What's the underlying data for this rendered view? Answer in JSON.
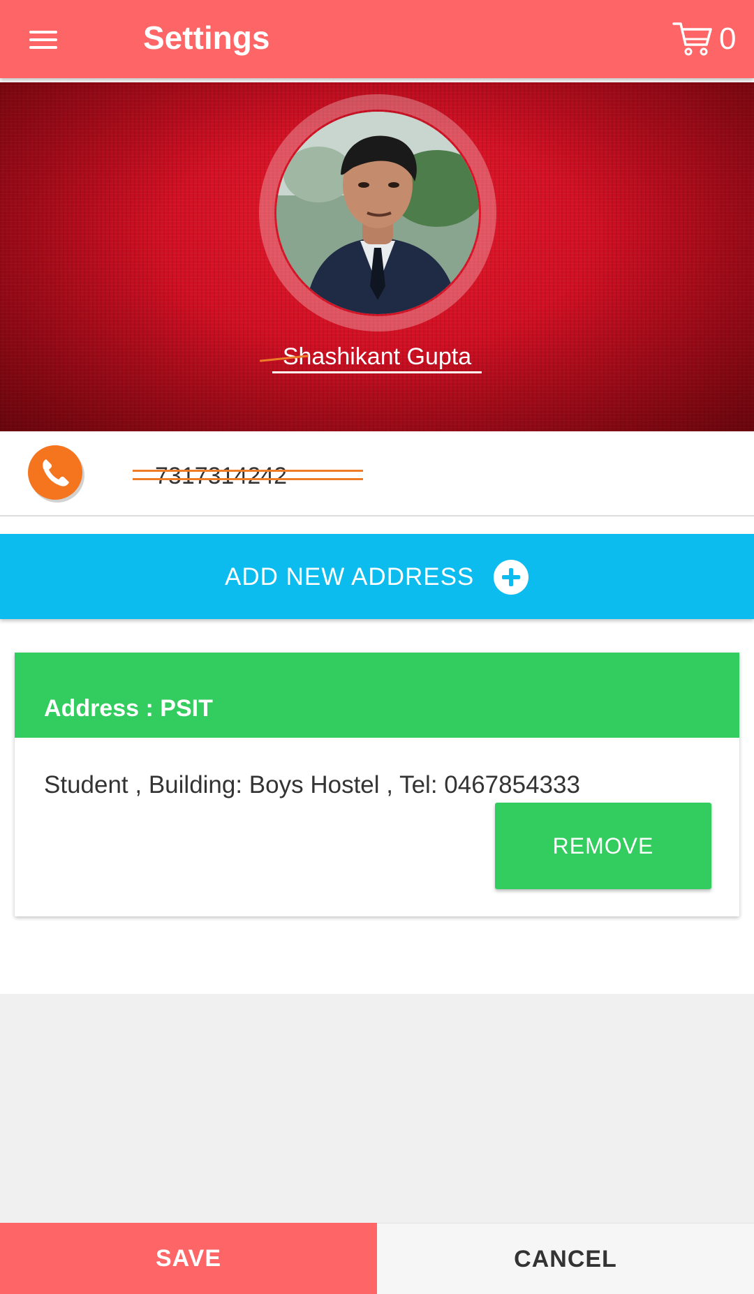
{
  "app_bar": {
    "title": "Settings",
    "cart_count": "0",
    "menu_icon": "hamburger-menu-icon",
    "cart_icon": "shopping-cart-icon"
  },
  "profile": {
    "name": "Shashikant Gupta",
    "phone": "7317314242",
    "phone_icon": "phone-icon"
  },
  "add_address": {
    "label": "ADD NEW ADDRESS",
    "icon": "plus-circle-icon"
  },
  "address_card": {
    "title": "Address : PSIT",
    "details": "Student , Building: Boys Hostel , Tel: 0467854333",
    "remove_label": "REMOVE"
  },
  "bottom_bar": {
    "save_label": "SAVE",
    "cancel_label": "CANCEL"
  },
  "colors": {
    "app_bar": "#fe6566",
    "cover": "#cf0f22",
    "phone_icon": "#f5751f",
    "add_address": "#0dbcee",
    "address_green": "#33cc5e",
    "save": "#fe6566",
    "cancel": "#f6f6f6"
  }
}
